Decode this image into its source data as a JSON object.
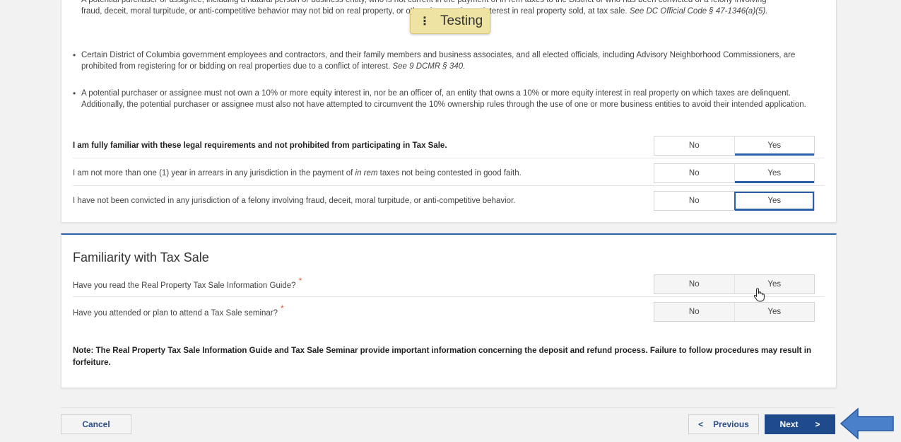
{
  "legal": {
    "bullet1_line1": "A potential purchaser or assignee, including a natural person or business entity, who is not current in the payment of in rem taxes to the District or who has been convicted of a felony involving",
    "bullet1_line2": "fraud, deceit, moral turpitude, or anti-competitive behavior may not bid on real property, or otherwise acquire an interest in real property sold, at tax sale.",
    "bullet1_cite": "See DC Official Code § 47-1346(a)(5).",
    "bullet2": "Certain District of Columbia government employees and contractors, and their family members and business associates, and all elected officials, including Advisory Neighborhood Commissioners, are prohibited from registering for or bidding on real properties due to a conflict of interest.",
    "bullet2_cite": "See 9 DCMR § 340.",
    "bullet3": "A potential purchaser or assignee must not own a 10% or more equity interest in, nor be an officer of, an entity that owns a 10% or more equity interest in real property on which taxes are delinquent. Additionally, the potential purchaser or assignee must also not have attempted to circumvent the 10% ownership rules through the use of one or more business entities to avoid their intended application."
  },
  "questions": [
    {
      "text": "I am fully familiar with these legal requirements and not prohibited from participating in Tax Sale.",
      "no": "No",
      "yes": "Yes",
      "selected": "Yes"
    },
    {
      "text_a": "I am not more than one (1) year in arrears in any jurisdiction in the payment of",
      "text_em": "in rem",
      "text_b": "taxes not being contested in good faith.",
      "no": "No",
      "yes": "Yes",
      "selected": "Yes"
    },
    {
      "text": "I have not been convicted in any jurisdiction of a felony involving fraud, deceit, moral turpitude, or anti-competitive behavior.",
      "no": "No",
      "yes": "Yes",
      "selected": "Yes"
    }
  ],
  "familiarity": {
    "title": "Familiarity with Tax Sale",
    "q1": {
      "text": "Have you read the Real Property Tax Sale Information Guide?",
      "required": "*",
      "no": "No",
      "yes": "Yes"
    },
    "q2": {
      "text": "Have you attended or plan to attend a Tax Sale seminar?",
      "required": "*",
      "no": "No",
      "yes": "Yes"
    },
    "note": "Note: The Real Property Tax Sale Information Guide and Tax Sale Seminar provide important information concerning the deposit and refund process. Failure to follow procedures may result in forfeiture."
  },
  "footer": {
    "cancel": "Cancel",
    "previous": "Previous",
    "next": "Next",
    "prev_chev": "<",
    "next_chev": ">"
  },
  "badge": {
    "label": "Testing",
    "icon": "⋮"
  },
  "colors": {
    "accent": "#2d5fa6",
    "next_bg": "#1f4a8c",
    "required": "#e05a3a",
    "arrow": "#4a7fc9"
  }
}
